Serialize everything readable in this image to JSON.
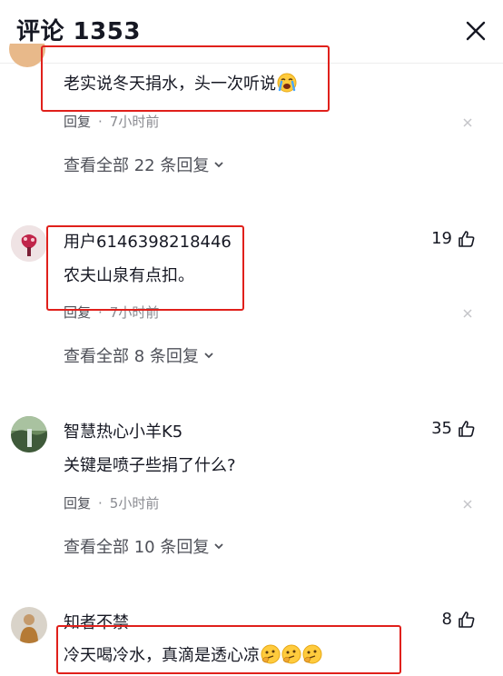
{
  "header": {
    "title": "评论 1353"
  },
  "comments": [
    {
      "text": "老实说冬天捐水，头一次听说",
      "reply_label": "回复",
      "time": "7小时前",
      "view_replies": "查看全部 22 条回复"
    },
    {
      "username": "用户6146398218446",
      "likes": "19",
      "text": "农夫山泉有点扣。",
      "reply_label": "回复",
      "time": "7小时前",
      "view_replies": "查看全部 8 条回复"
    },
    {
      "username": "智慧热心小羊K5",
      "likes": "35",
      "text": "关键是喷子些捐了什么?",
      "reply_label": "回复",
      "time": "5小时前",
      "view_replies": "查看全部 10 条回复"
    },
    {
      "username": "知者不禁",
      "likes": "8",
      "text": "冷天喝冷水，真滴是透心凉"
    }
  ],
  "separator": "·",
  "icons": {
    "close": "close-icon",
    "like": "thumbs-up-icon",
    "chevron": "chevron-down-icon",
    "dismiss": "x-icon"
  },
  "colors": {
    "highlight_box": "#e0201b",
    "secondary_text": "#8a8b91"
  }
}
